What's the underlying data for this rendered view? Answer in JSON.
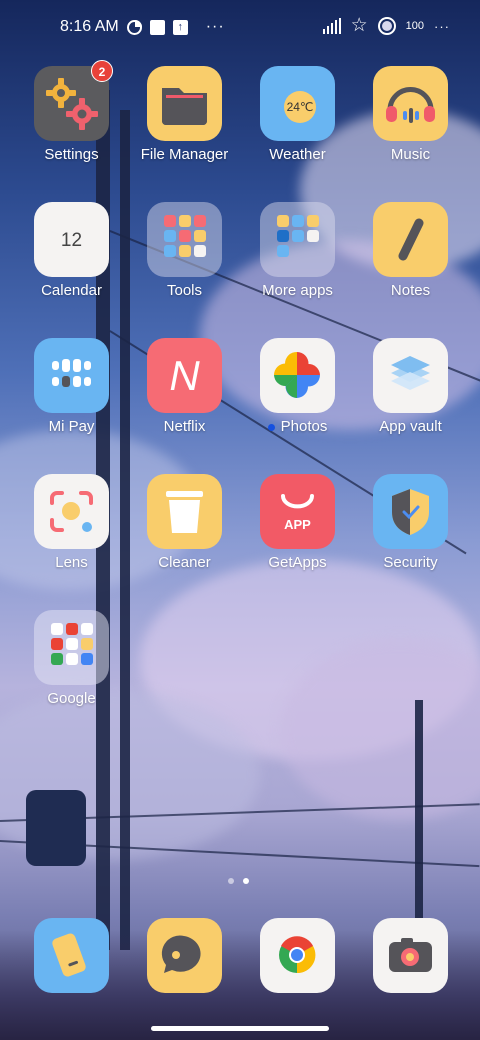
{
  "status_bar": {
    "time": "8:16 AM",
    "battery": "100",
    "overflow": "···",
    "right_overflow": "···"
  },
  "apps": [
    {
      "label": "Settings",
      "icon": "settings-icon",
      "badge": "2"
    },
    {
      "label": "File Manager",
      "icon": "folder-icon"
    },
    {
      "label": "Weather",
      "icon": "weather-icon",
      "value": "24℃"
    },
    {
      "label": "Music",
      "icon": "headphones-icon"
    },
    {
      "label": "Calendar",
      "icon": "calendar-icon",
      "value": "12"
    },
    {
      "label": "Tools",
      "icon": "folder-tools-icon"
    },
    {
      "label": "More apps",
      "icon": "folder-more-apps-icon"
    },
    {
      "label": "Notes",
      "icon": "notes-pen-icon"
    },
    {
      "label": "Mi Pay",
      "icon": "mi-pay-icon"
    },
    {
      "label": "Netflix",
      "icon": "netflix-icon",
      "glyph": "N"
    },
    {
      "label": "Photos",
      "icon": "google-photos-icon",
      "new": true
    },
    {
      "label": "App vault",
      "icon": "app-vault-icon"
    },
    {
      "label": "Lens",
      "icon": "lens-icon"
    },
    {
      "label": "Cleaner",
      "icon": "trash-bin-icon"
    },
    {
      "label": "GetApps",
      "icon": "getapps-bag-icon",
      "glyph": "APP"
    },
    {
      "label": "Security",
      "icon": "shield-check-icon"
    },
    {
      "label": "Google",
      "icon": "folder-google-icon"
    }
  ],
  "page_indicator": {
    "pages": 2,
    "active": 2
  },
  "dock": [
    {
      "name": "phone",
      "icon": "phone-icon"
    },
    {
      "name": "messages",
      "icon": "message-bubble-icon"
    },
    {
      "name": "chrome",
      "icon": "chrome-icon"
    },
    {
      "name": "camera",
      "icon": "camera-icon"
    }
  ],
  "colors": {
    "icon_yellow": "#f9cd6b",
    "icon_blue": "#69b5f2",
    "icon_red": "#f66b74",
    "icon_white": "#f5f3f2",
    "badge_red": "#e8423a"
  }
}
